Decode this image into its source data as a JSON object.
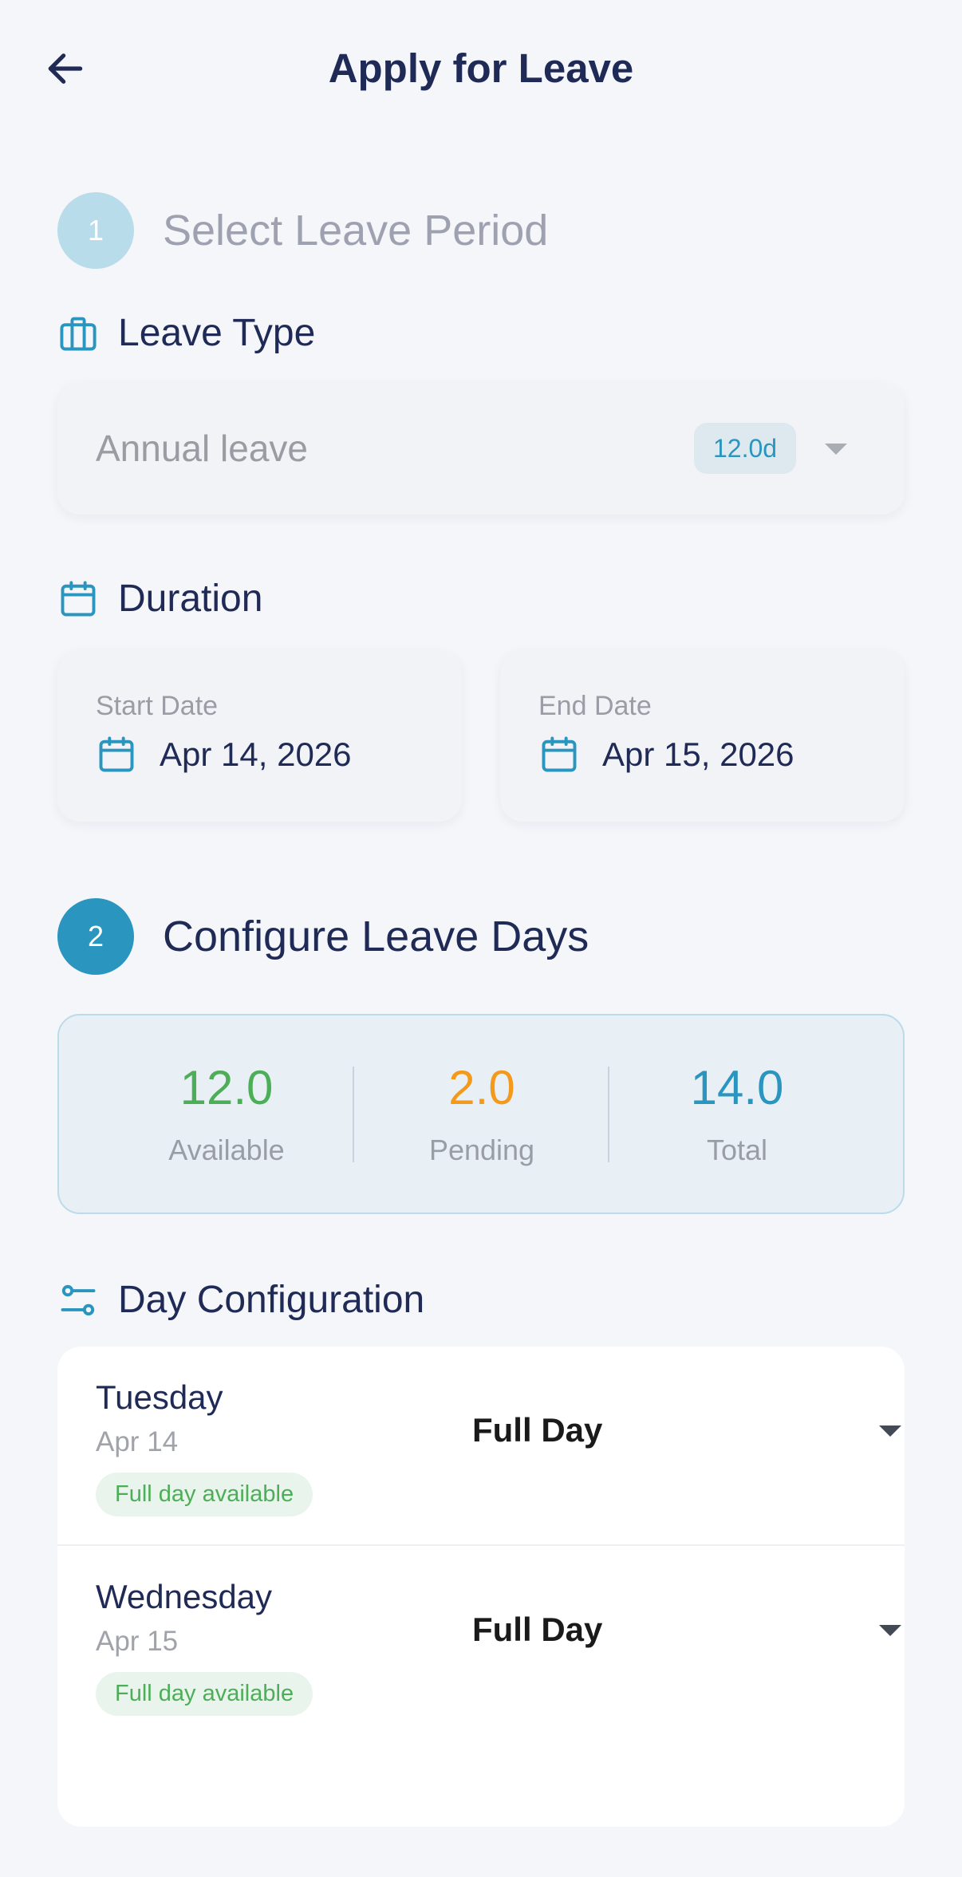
{
  "header": {
    "title": "Apply for Leave",
    "back_icon": "arrow-left-icon"
  },
  "colors": {
    "primary_dark": "#1f2a56",
    "accent": "#2a95bf",
    "step1_circle": "#b9dcea",
    "step2_circle": "#2a95bf",
    "available": "#4cae57",
    "pending": "#f39a1c",
    "total": "#2a95bf",
    "background": "#f4f6fa"
  },
  "step1": {
    "number": "1",
    "title": "Select Leave Period"
  },
  "leave_type": {
    "label": "Leave Type",
    "icon": "briefcase-icon",
    "value": "Annual leave",
    "balance": "12.0d"
  },
  "duration": {
    "label": "Duration",
    "icon": "calendar-icon",
    "start_label": "Start Date",
    "start_value": "Apr 14, 2026",
    "end_label": "End Date",
    "end_value": "Apr 15, 2026"
  },
  "step2": {
    "number": "2",
    "title": "Configure Leave Days"
  },
  "stats": {
    "available_value": "12.0",
    "available_label": "Available",
    "pending_value": "2.0",
    "pending_label": "Pending",
    "total_value": "14.0",
    "total_label": "Total"
  },
  "day_config": {
    "label": "Day Configuration",
    "icon": "sliders-icon",
    "days": [
      {
        "name": "Tuesday",
        "date": "Apr 14",
        "availability": "Full day available",
        "selection": "Full Day"
      },
      {
        "name": "Wednesday",
        "date": "Apr 15",
        "availability": "Full day available",
        "selection": "Full Day"
      }
    ]
  }
}
